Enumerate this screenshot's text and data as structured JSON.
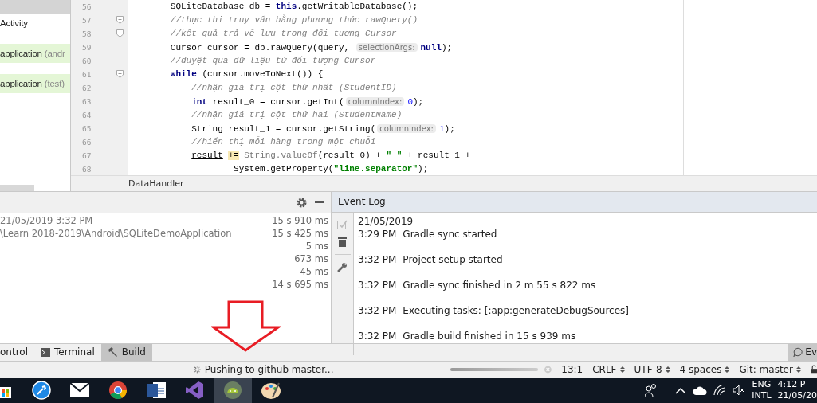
{
  "project_panel": {
    "items": [
      {
        "label": "Activity",
        "highlighted": false
      },
      {
        "label": "application",
        "suffix": " (andr",
        "highlighted": true
      },
      {
        "label": "application",
        "suffix": " (test)",
        "highlighted": true
      }
    ]
  },
  "editor": {
    "lines": [
      {
        "number": "56",
        "fold": false,
        "segments": [
          {
            "kind": "plain",
            "text": "        SQLiteDatabase db = "
          },
          {
            "kind": "keyword",
            "text": "this"
          },
          {
            "kind": "plain",
            "text": ".getWritableDatabase();"
          }
        ]
      },
      {
        "number": "57",
        "fold": true,
        "segments": [
          {
            "kind": "comment",
            "text": "        //thực thi truy vấn bằng phương thức rawQuery()"
          }
        ]
      },
      {
        "number": "58",
        "fold": true,
        "segments": [
          {
            "kind": "comment",
            "text": "        //kết quả trả về lưu trong đối tượng Cursor"
          }
        ]
      },
      {
        "number": "59",
        "fold": false,
        "segments": [
          {
            "kind": "plain",
            "text": "        Cursor cursor = db.rawQuery(query, "
          },
          {
            "kind": "hint",
            "text": "selectionArgs:"
          },
          {
            "kind": "keyword",
            "text": "null"
          },
          {
            "kind": "plain",
            "text": ");"
          }
        ]
      },
      {
        "number": "60",
        "fold": false,
        "segments": [
          {
            "kind": "comment",
            "text": "        //duyệt qua dữ liệu từ đối tượng Cursor"
          }
        ]
      },
      {
        "number": "61",
        "fold": true,
        "segments": [
          {
            "kind": "keyword",
            "text": "        while"
          },
          {
            "kind": "plain",
            "text": " (cursor.moveToNext()) {"
          }
        ]
      },
      {
        "number": "62",
        "fold": false,
        "segments": [
          {
            "kind": "comment",
            "text": "            //nhận giá trị cột thứ nhất (StudentID)"
          }
        ]
      },
      {
        "number": "63",
        "fold": false,
        "segments": [
          {
            "kind": "keyword",
            "text": "            int"
          },
          {
            "kind": "plain",
            "text": " result_0 = cursor.getInt("
          },
          {
            "kind": "hint",
            "text": "columnIndex:"
          },
          {
            "kind": "number",
            "text": "0"
          },
          {
            "kind": "plain",
            "text": ");"
          }
        ]
      },
      {
        "number": "64",
        "fold": false,
        "segments": [
          {
            "kind": "comment",
            "text": "            //nhận giá trị cột thứ hai (StudentName)"
          }
        ]
      },
      {
        "number": "65",
        "fold": false,
        "segments": [
          {
            "kind": "plain",
            "text": "            String result_1 = cursor.getString("
          },
          {
            "kind": "hint",
            "text": "columnIndex:"
          },
          {
            "kind": "number",
            "text": "1"
          },
          {
            "kind": "plain",
            "text": ");"
          }
        ]
      },
      {
        "number": "66",
        "fold": false,
        "segments": [
          {
            "kind": "comment",
            "text": "            //hiển thị mỗi hàng trong một chuỗi"
          }
        ]
      },
      {
        "number": "67",
        "fold": false,
        "segments": [
          {
            "kind": "underlined",
            "text": "            result"
          },
          {
            "kind": "highlight",
            "text": " += "
          },
          {
            "kind": "muted",
            "text": "String.valueOf"
          },
          {
            "kind": "plain",
            "text": "(result_0) + "
          },
          {
            "kind": "string",
            "text": "\" \""
          },
          {
            "kind": "plain",
            "text": " + result_1 +"
          }
        ]
      },
      {
        "number": "68",
        "fold": false,
        "segments": [
          {
            "kind": "plain",
            "text": "                    System.getProperty("
          },
          {
            "kind": "string",
            "text": "\"line.separator\""
          },
          {
            "kind": "plain",
            "text": ");"
          }
        ]
      }
    ],
    "breadcrumb": "DataHandler"
  },
  "build_panel": {
    "rows": [
      {
        "text": "21/05/2019 3:32 PM",
        "duration": "15 s 910 ms"
      },
      {
        "text": "\\Learn 2018-2019\\Android\\SQLiteDemoApplication",
        "duration": "15 s 425 ms"
      },
      {
        "duration": "5 ms"
      },
      {
        "duration": "673 ms"
      },
      {
        "duration": "45 ms"
      },
      {
        "duration": "14 s 695 ms"
      }
    ]
  },
  "event_log": {
    "title": "Event Log",
    "date": "21/05/2019",
    "entries": [
      {
        "time": "3:29 PM",
        "message": "Gradle sync started"
      },
      {
        "time": "3:32 PM",
        "message": "Project setup started"
      },
      {
        "time": "3:32 PM",
        "message": "Gradle sync finished in 2 m 55 s 822 ms"
      },
      {
        "time": "3:32 PM",
        "message": "Executing tasks: [:app:generateDebugSources]"
      },
      {
        "time": "3:32 PM",
        "message": "Gradle build finished in 15 s 939 ms"
      }
    ]
  },
  "tool_tabs": [
    {
      "kind": "plain",
      "label": "ontrol",
      "selected": false
    },
    {
      "kind": "terminal",
      "label": "Terminal",
      "selected": false
    },
    {
      "kind": "build",
      "label": "Build",
      "selected": true
    }
  ],
  "right_tool_tab": {
    "label": "Ev"
  },
  "status_bar": {
    "message": "Pushing to github master...",
    "progress": {
      "level": 1
    },
    "items": [
      {
        "label": "13:1",
        "menu": false
      },
      {
        "label": "CRLF",
        "menu": true
      },
      {
        "label": "UTF-8",
        "menu": true
      },
      {
        "label": "4 spaces",
        "menu": true
      },
      {
        "label": "Git: master",
        "menu": true
      }
    ]
  },
  "taskbar": {
    "apps": [
      {
        "kind": "store",
        "selected": false
      },
      {
        "kind": "wrench",
        "selected": false
      },
      {
        "kind": "mail",
        "selected": false
      },
      {
        "kind": "browser",
        "selected": false
      },
      {
        "kind": "word",
        "selected": false
      },
      {
        "kind": "studio",
        "selected": false
      },
      {
        "kind": "android",
        "selected": true
      },
      {
        "kind": "paint",
        "selected": false
      }
    ],
    "language": "ENG",
    "layout": "INTL",
    "time": "4:12 P",
    "date": "21/05/20"
  }
}
